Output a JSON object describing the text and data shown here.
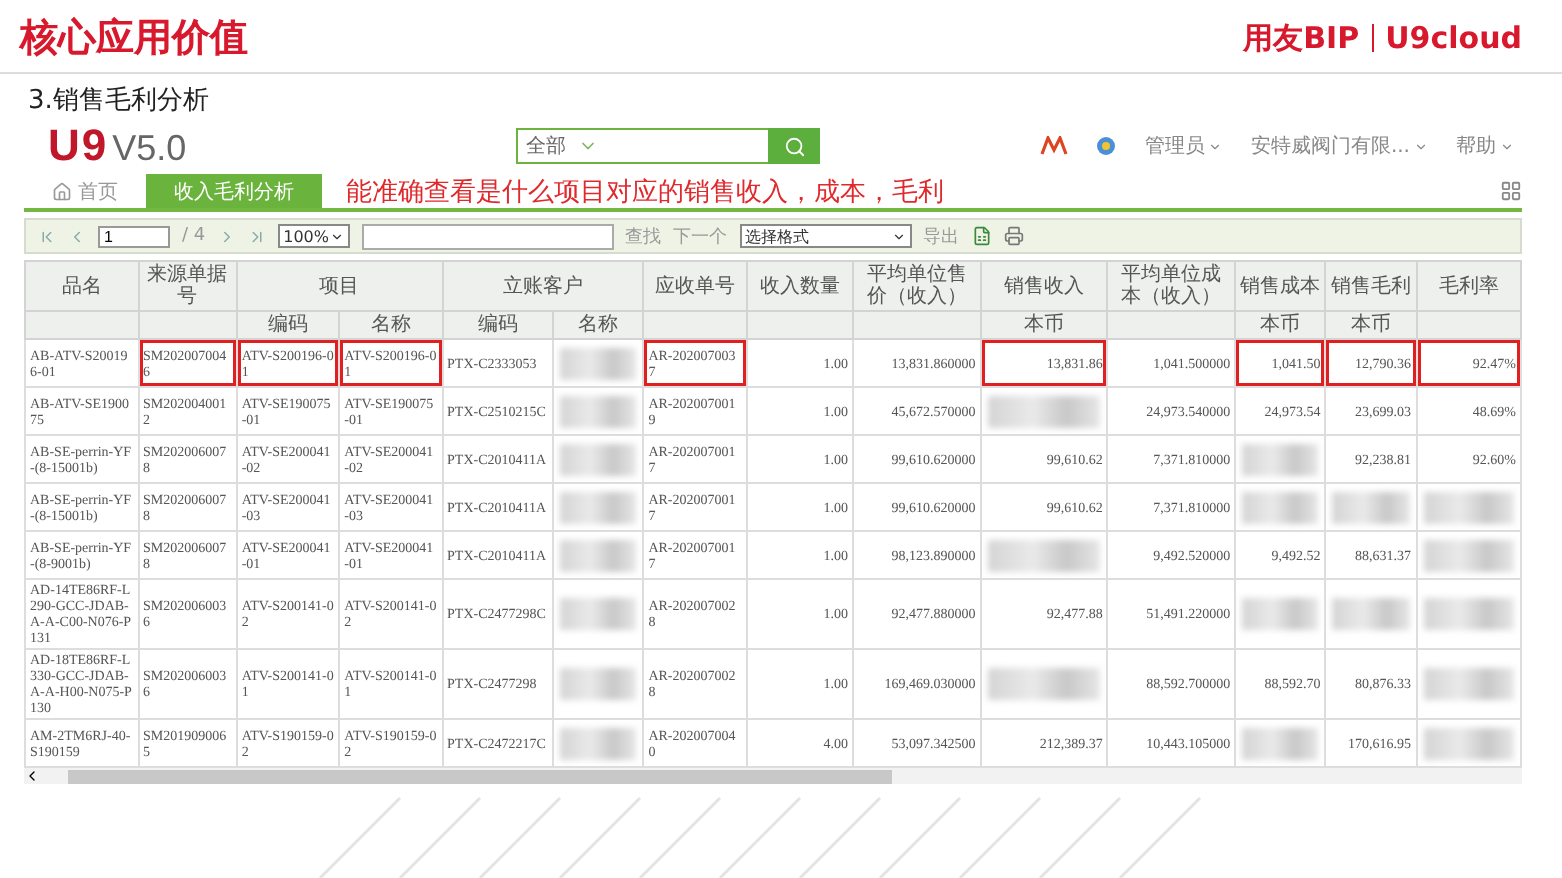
{
  "slide": {
    "title": "核心应用价值",
    "brand": "用友BIP",
    "brand_product": "U9cloud",
    "subtitle": "3.销售毛利分析"
  },
  "app": {
    "logo": "U9",
    "version": "V5.0",
    "search_scope": "全部",
    "user_menu": [
      {
        "label": "管理员"
      },
      {
        "label": "安特威阀门有限..."
      },
      {
        "label": "帮助"
      }
    ],
    "tabs": [
      {
        "label": "首页",
        "selected": false,
        "kind": "home"
      },
      {
        "label": "收入毛利分析",
        "selected": true,
        "kind": "page"
      }
    ],
    "annotation": "能准确查看是什么项目对应的销售收入，成本，毛利",
    "toolbar": {
      "page": "1",
      "page_count": "/ 4",
      "zoom": "100%",
      "find": "查找",
      "find_next": "下一个",
      "format": "选择格式",
      "export": "导出"
    },
    "table": {
      "columns": [
        {
          "label": "品名"
        },
        {
          "label": "来源单据号"
        },
        {
          "label": "项目",
          "colspan": 2,
          "sub": [
            "编码",
            "名称"
          ]
        },
        {
          "label": "立账客户",
          "colspan": 2,
          "sub": [
            "编码",
            "名称"
          ]
        },
        {
          "label": "应收单号"
        },
        {
          "label": "收入数量"
        },
        {
          "label": "平均单位售价（收入）"
        },
        {
          "label": "销售收入",
          "sub": [
            "本币"
          ]
        },
        {
          "label": "平均单位成本（收入）"
        },
        {
          "label": "销售成本",
          "sub": [
            "本币"
          ]
        },
        {
          "label": "销售毛利",
          "sub": [
            "本币"
          ]
        },
        {
          "label": "毛利率"
        }
      ],
      "rows": [
        [
          "AB-ATV-S200196-01",
          {
            "text": "SM2020070046",
            "boxed": true
          },
          {
            "text": "ATV-S200196-01",
            "boxed": true
          },
          {
            "text": "ATV-S200196-01",
            "boxed": true
          },
          "PTX-C2333053",
          {
            "kind": "blurred"
          },
          {
            "text": "AR-2020070037",
            "boxed": true
          },
          "1.00",
          "13,831.860000",
          {
            "text": "13,831.86",
            "boxed": true
          },
          "1,041.500000",
          {
            "text": "1,041.50",
            "boxed": true
          },
          {
            "text": "12,790.36",
            "boxed": true
          },
          {
            "text": "92.47%",
            "boxed": true
          }
        ],
        [
          "AB-ATV-SE190075",
          "SM2020040012",
          "ATV-SE190075-01",
          "ATV-SE190075-01",
          "PTX-C2510215C",
          {
            "kind": "blurred"
          },
          "AR-2020070019",
          "1.00",
          "45,672.570000",
          {
            "kind": "blurred"
          },
          "24,973.540000",
          "24,973.54",
          "23,699.03",
          "48.69%"
        ],
        [
          "AB-SE-perrin-YF-(8-15001b)",
          "SM2020060078",
          "ATV-SE200041-02",
          "ATV-SE200041-02",
          "PTX-C2010411A",
          {
            "kind": "blurred"
          },
          "AR-2020070017",
          "1.00",
          "99,610.620000",
          "99,610.62",
          "7,371.810000",
          {
            "kind": "blurred"
          },
          "92,238.81",
          "92.60%"
        ],
        [
          "AB-SE-perrin-YF-(8-15001b)",
          "SM2020060078",
          "ATV-SE200041-03",
          "ATV-SE200041-03",
          "PTX-C2010411A",
          {
            "kind": "blurred"
          },
          "AR-2020070017",
          "1.00",
          "99,610.620000",
          "99,610.62",
          "7,371.810000",
          {
            "kind": "blurred"
          },
          {
            "kind": "blurred"
          },
          {
            "kind": "blurred"
          }
        ],
        [
          "AB-SE-perrin-YF-(8-9001b)",
          "SM2020060078",
          "ATV-SE200041-01",
          "ATV-SE200041-01",
          "PTX-C2010411A",
          {
            "kind": "blurred"
          },
          "AR-2020070017",
          "1.00",
          "98,123.890000",
          {
            "kind": "blurred"
          },
          "9,492.520000",
          "9,492.52",
          "88,631.37",
          {
            "kind": "blurred"
          }
        ],
        [
          "AD-14TE86RF-L290-GCC-JDAB-A-A-C00-N076-P131",
          "SM2020060036",
          "ATV-S200141-02",
          "ATV-S200141-02",
          "PTX-C2477298C",
          {
            "kind": "blurred"
          },
          "AR-2020070028",
          "1.00",
          "92,477.880000",
          "92,477.88",
          "51,491.220000",
          {
            "kind": "blurred"
          },
          {
            "kind": "blurred"
          },
          {
            "kind": "blurred"
          }
        ],
        [
          "AD-18TE86RF-L330-GCC-JDAB-A-A-H00-N075-P130",
          "SM2020060036",
          "ATV-S200141-01",
          "ATV-S200141-01",
          "PTX-C2477298",
          {
            "kind": "blurred"
          },
          "AR-2020070028",
          "1.00",
          "169,469.030000",
          {
            "kind": "blurred"
          },
          "88,592.700000",
          "88,592.70",
          "80,876.33",
          {
            "kind": "blurred"
          }
        ],
        [
          "AM-2TM6RJ-40-S190159",
          "SM2019090065",
          "ATV-S190159-02",
          "ATV-S190159-02",
          "PTX-C2472217C",
          {
            "kind": "blurred"
          },
          "AR-2020070040",
          "4.00",
          "53,097.342500",
          "212,389.37",
          "10,443.105000",
          {
            "kind": "blurred"
          },
          "170,616.95",
          {
            "kind": "blurred"
          }
        ]
      ]
    }
  }
}
